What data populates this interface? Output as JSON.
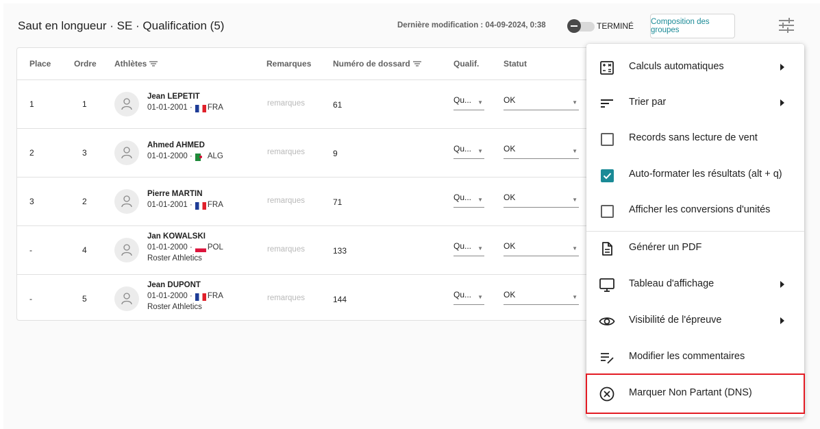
{
  "header": {
    "title": "Saut en longueur · SE · Qualification (5)",
    "last_modified": "Dernière modification : 04-09-2024, 0:38",
    "toggle_label": "TERMINÉ",
    "compose_button": "Composition des groupes"
  },
  "table": {
    "columns": {
      "place": "Place",
      "ordre": "Ordre",
      "athletes": "Athlètes",
      "remarques": "Remarques",
      "dossard": "Numéro de dossard",
      "qualif": "Qualif.",
      "statut": "Statut"
    },
    "rows": [
      {
        "place": "1",
        "ordre": "1",
        "name": "Jean LEPETIT",
        "dob": "01-01-2001 ·",
        "country": "FRA",
        "club": "",
        "remark": "remarques",
        "dossard": "61",
        "qualif": "Qu...",
        "statut": "OK"
      },
      {
        "place": "2",
        "ordre": "3",
        "name": "Ahmed AHMED",
        "dob": "01-01-2000 ·",
        "country": "ALG",
        "club": "",
        "remark": "remarques",
        "dossard": "9",
        "qualif": "Qu...",
        "statut": "OK"
      },
      {
        "place": "3",
        "ordre": "2",
        "name": "Pierre MARTIN",
        "dob": "01-01-2001 ·",
        "country": "FRA",
        "club": "",
        "remark": "remarques",
        "dossard": "71",
        "qualif": "Qu...",
        "statut": "OK"
      },
      {
        "place": "-",
        "ordre": "4",
        "name": "Jan KOWALSKI",
        "dob": "01-01-2000 ·",
        "country": "POL",
        "club": "Roster Athletics",
        "remark": "remarques",
        "dossard": "133",
        "qualif": "Qu...",
        "statut": "OK"
      },
      {
        "place": "-",
        "ordre": "5",
        "name": "Jean DUPONT",
        "dob": "01-01-2000 ·",
        "country": "FRA",
        "club": "Roster Athletics",
        "remark": "remarques",
        "dossard": "144",
        "qualif": "Qu...",
        "statut": "OK"
      }
    ]
  },
  "menu": {
    "items": [
      {
        "label": "Calculs automatiques",
        "icon": "calculator-icon"
      },
      {
        "label": "Trier par",
        "icon": "sort-icon"
      },
      {
        "label": "Records sans lecture de vent",
        "icon": "checkbox-unchecked",
        "checked": false
      },
      {
        "label": "Auto-formater les résultats (alt + q)",
        "icon": "checkbox-checked",
        "checked": true
      },
      {
        "label": "Afficher les conversions d'unités",
        "icon": "checkbox-unchecked",
        "checked": false
      },
      {
        "label": "Générer un PDF",
        "icon": "document-icon"
      },
      {
        "label": "Tableau d'affichage",
        "icon": "monitor-icon"
      },
      {
        "label": "Visibilité de l'épreuve",
        "icon": "eye-icon"
      },
      {
        "label": "Modifier les commentaires",
        "icon": "edit-notes-icon"
      },
      {
        "label": "Marquer Non Partant (DNS)",
        "icon": "cancel-circle-icon"
      }
    ]
  },
  "colors": {
    "accent": "#1a8a96",
    "highlight_border": "#e31b23"
  }
}
